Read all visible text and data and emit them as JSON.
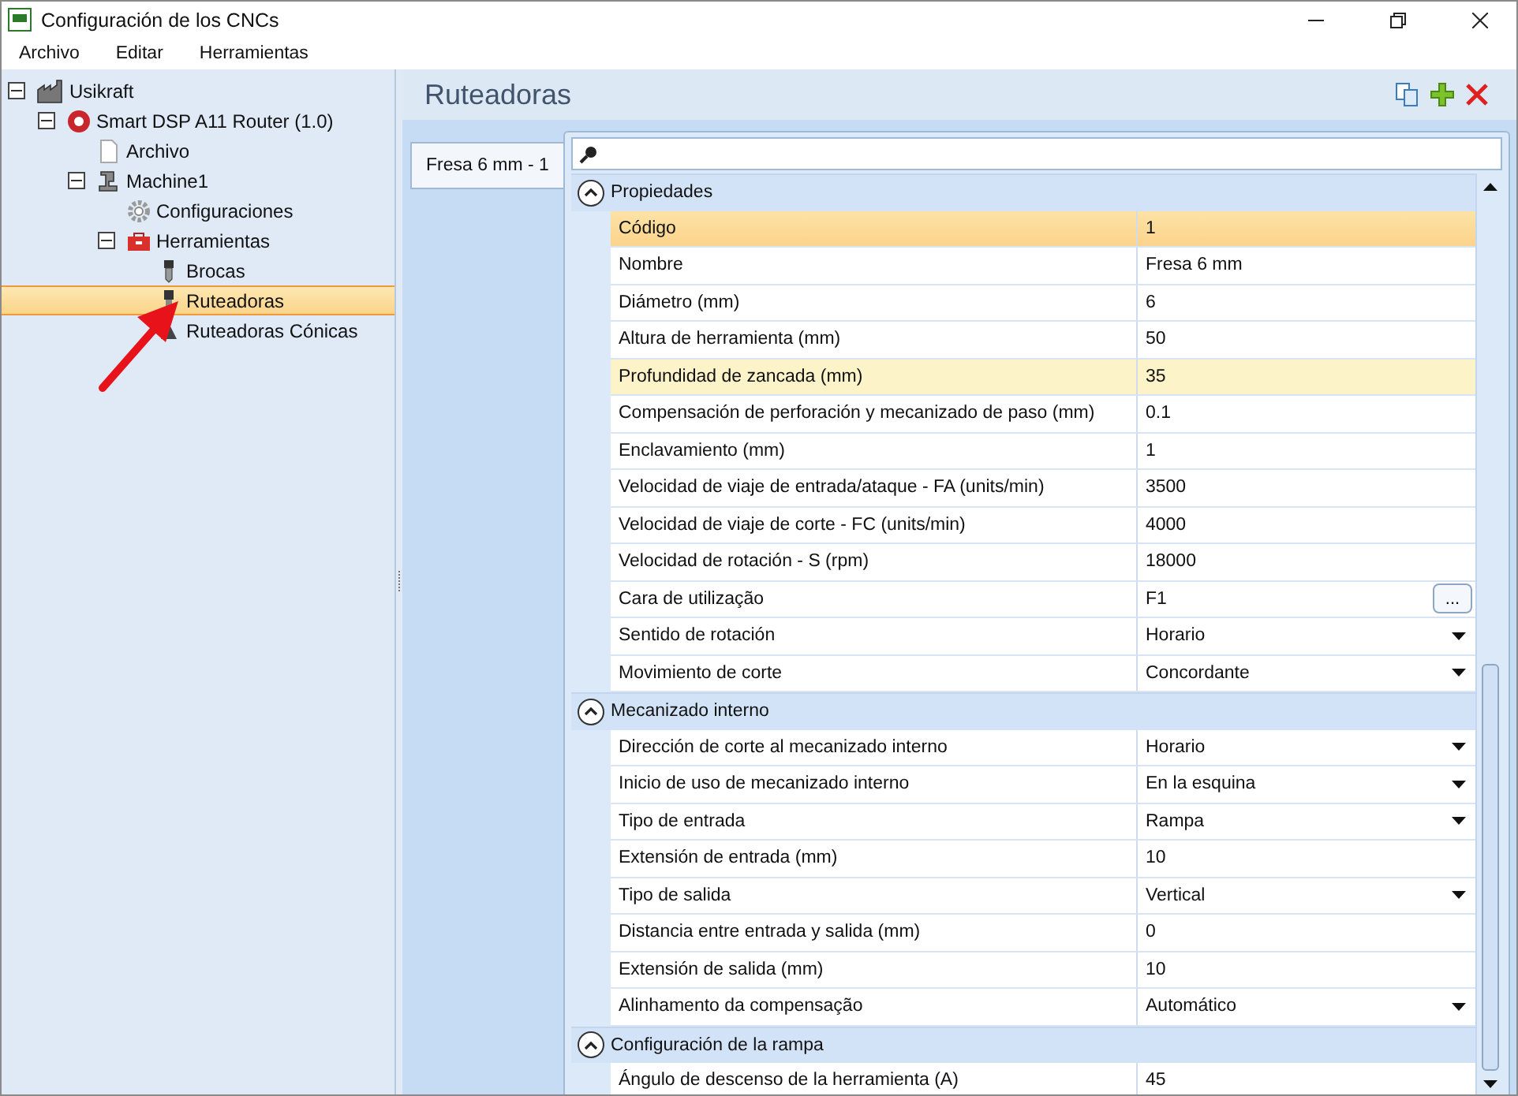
{
  "window": {
    "title": "Configuración de los CNCs"
  },
  "menu": [
    "Archivo",
    "Editar",
    "Herramientas"
  ],
  "tree": [
    {
      "label": "Usikraft",
      "kind": "factory",
      "expanded": true,
      "selected": false,
      "children": [
        {
          "label": "Smart DSP A11 Router (1.0)",
          "kind": "brand",
          "expanded": true,
          "selected": false,
          "children": [
            {
              "label": "Archivo",
              "kind": "document",
              "selected": false
            },
            {
              "label": "Machine1",
              "kind": "machine",
              "expanded": true,
              "selected": false,
              "children": [
                {
                  "label": "Configuraciones",
                  "kind": "gear",
                  "selected": false
                },
                {
                  "label": "Herramientas",
                  "kind": "toolbox",
                  "expanded": true,
                  "selected": false,
                  "children": [
                    {
                      "label": "Brocas",
                      "kind": "drill",
                      "selected": false
                    },
                    {
                      "label": "Ruteadoras",
                      "kind": "router",
                      "selected": true
                    },
                    {
                      "label": "Ruteadoras Cónicas",
                      "kind": "cone",
                      "selected": false
                    }
                  ]
                }
              ]
            }
          ]
        }
      ]
    }
  ],
  "panel": {
    "title": "Ruteadoras"
  },
  "tool_tabs": [
    {
      "label": "Fresa 6 mm - 1",
      "selected": true
    }
  ],
  "sections": [
    {
      "title": "Propiedades",
      "expanded": true,
      "rows": [
        {
          "name": "Código",
          "value": "1",
          "kind": "text",
          "selected": true,
          "hovered": false
        },
        {
          "name": "Nombre",
          "value": "Fresa 6 mm",
          "kind": "text",
          "selected": false,
          "hovered": false
        },
        {
          "name": "Diámetro (mm)",
          "value": "6",
          "kind": "text",
          "selected": false,
          "hovered": false
        },
        {
          "name": "Altura de herramienta (mm)",
          "value": "50",
          "kind": "text",
          "selected": false,
          "hovered": false
        },
        {
          "name": "Profundidad de zancada (mm)",
          "value": "35",
          "kind": "text",
          "selected": false,
          "hovered": true
        },
        {
          "name": "Compensación de perforación y mecanizado de paso (mm)",
          "value": "0.1",
          "kind": "text",
          "selected": false,
          "hovered": false
        },
        {
          "name": "Enclavamiento (mm)",
          "value": "1",
          "kind": "text",
          "selected": false,
          "hovered": false
        },
        {
          "name": "Velocidad de viaje de entrada/ataque - FA (units/min)",
          "value": "3500",
          "kind": "text",
          "selected": false,
          "hovered": false
        },
        {
          "name": "Velocidad de viaje de corte - FC (units/min)",
          "value": "4000",
          "kind": "text",
          "selected": false,
          "hovered": false
        },
        {
          "name": "Velocidad de rotación - S (rpm)",
          "value": "18000",
          "kind": "text",
          "selected": false,
          "hovered": false
        },
        {
          "name": "Cara de utilização",
          "value": "F1",
          "kind": "browse",
          "button": "...",
          "selected": false,
          "hovered": false
        },
        {
          "name": "Sentido de rotación",
          "value": "Horario",
          "kind": "dropdown",
          "selected": false,
          "hovered": false
        },
        {
          "name": "Movimiento de corte",
          "value": "Concordante",
          "kind": "dropdown",
          "selected": false,
          "hovered": false
        }
      ]
    },
    {
      "title": "Mecanizado interno",
      "expanded": true,
      "rows": [
        {
          "name": "Dirección de corte al mecanizado interno",
          "value": "Horario",
          "kind": "dropdown",
          "selected": false,
          "hovered": false
        },
        {
          "name": "Inicio de uso de mecanizado interno",
          "value": "En la esquina",
          "kind": "dropdown",
          "selected": false,
          "hovered": false
        },
        {
          "name": "Tipo de entrada",
          "value": "Rampa",
          "kind": "dropdown",
          "selected": false,
          "hovered": false
        },
        {
          "name": "Extensión de entrada (mm)",
          "value": "10",
          "kind": "text",
          "selected": false,
          "hovered": false
        },
        {
          "name": "Tipo de salida",
          "value": "Vertical",
          "kind": "dropdown",
          "selected": false,
          "hovered": false
        },
        {
          "name": "Distancia entre entrada y salida (mm)",
          "value": "0",
          "kind": "text",
          "selected": false,
          "hovered": false
        },
        {
          "name": "Extensión de salida (mm)",
          "value": "10",
          "kind": "text",
          "selected": false,
          "hovered": false
        },
        {
          "name": "Alinhamento da compensação",
          "value": "Automático",
          "kind": "dropdown",
          "selected": false,
          "hovered": false
        }
      ]
    },
    {
      "title": "Configuración de la rampa",
      "expanded": true,
      "rows": [
        {
          "name": "Ángulo de descenso de la herramienta (A)",
          "value": "45",
          "kind": "text",
          "selected": false,
          "hovered": false
        }
      ]
    }
  ]
}
